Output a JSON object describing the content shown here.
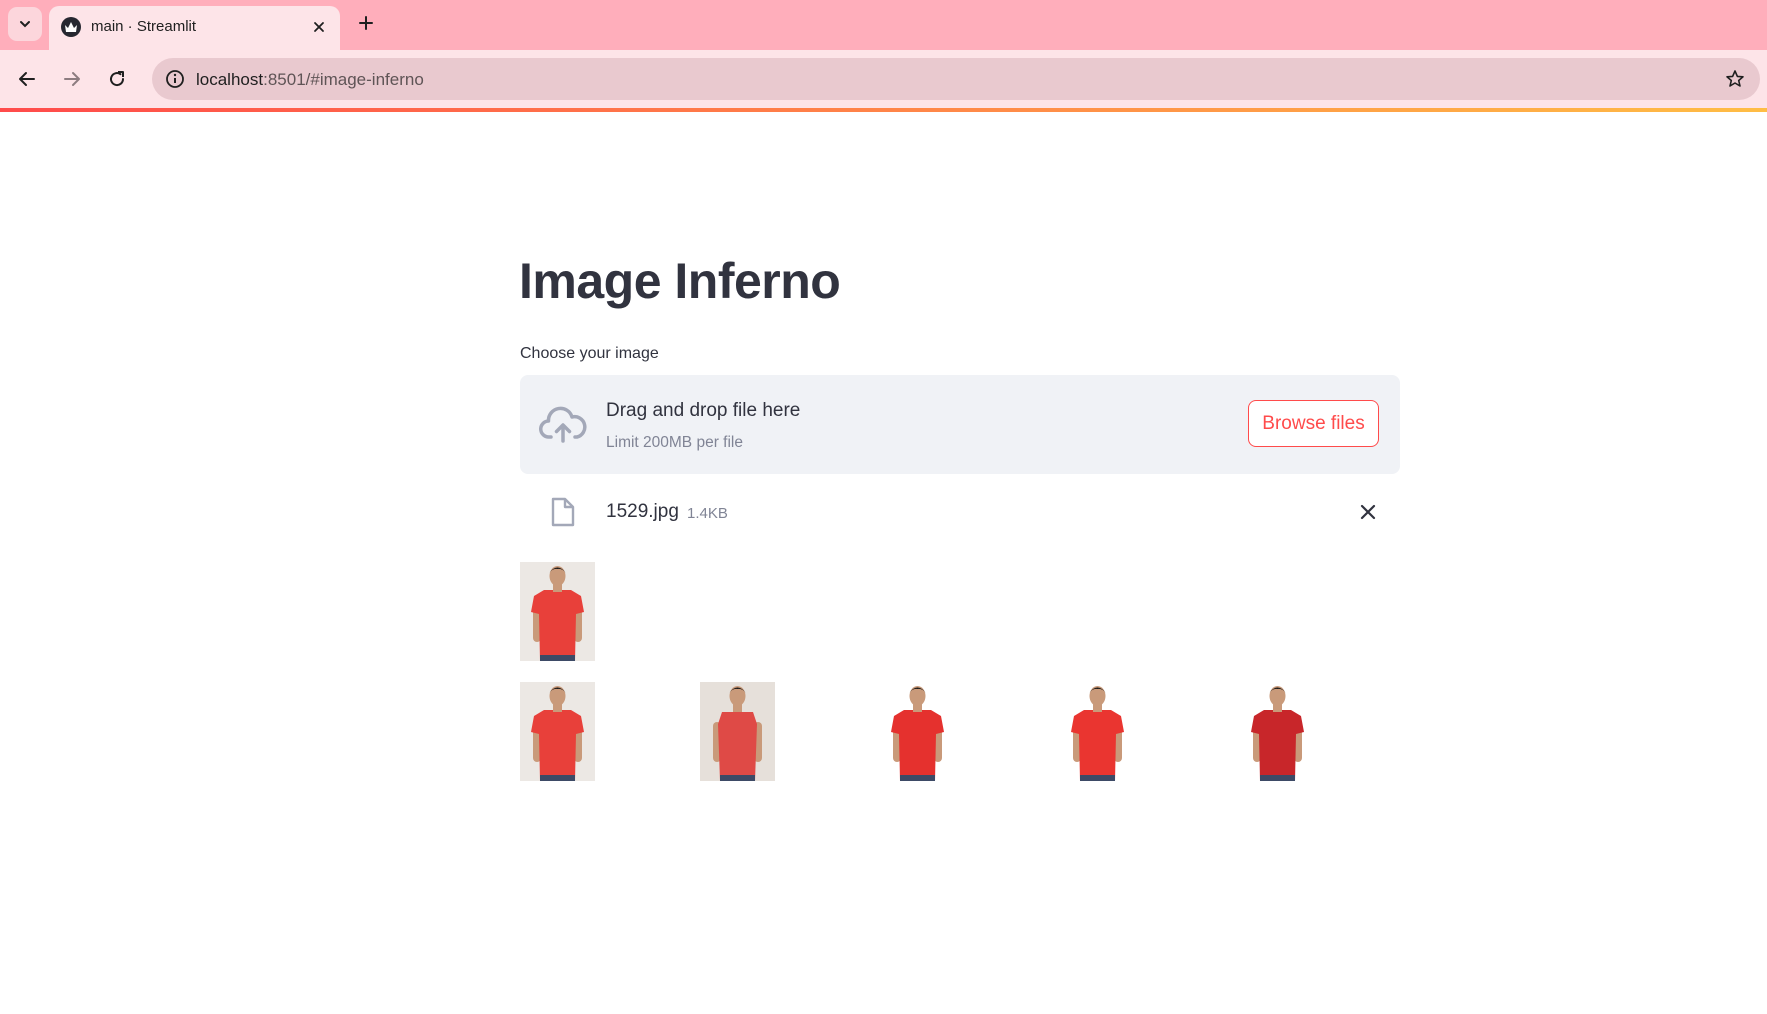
{
  "browser": {
    "tab_title": "main · Streamlit",
    "url_host": "localhost",
    "url_path": ":8501/#image-inferno",
    "icons": [
      "chevron-down-icon",
      "streamlit-favicon",
      "close-icon",
      "plus-icon",
      "back-arrow-icon",
      "forward-arrow-icon",
      "reload-icon",
      "info-icon",
      "star-icon"
    ]
  },
  "app": {
    "title": "Image Inferno",
    "uploader": {
      "label": "Choose your image",
      "drop_text": "Drag and drop file here",
      "limit_text": "Limit 200MB per file",
      "browse_label": "Browse files"
    },
    "uploaded_file": {
      "name": "1529.jpg",
      "size": "1.4KB"
    },
    "query_image": {
      "subject": "man in red t-shirt",
      "bg": "#ece8e4",
      "shirt": "#e8403a"
    },
    "results": [
      {
        "subject": "man in red t-shirt",
        "bg": "#ece8e4",
        "shirt": "#e8403a"
      },
      {
        "subject": "man in red sleeveless shirt",
        "bg": "#e6e0da",
        "shirt": "#df4a46"
      },
      {
        "subject": "man in red t-shirt",
        "bg": "#ffffff",
        "shirt": "#e5312e"
      },
      {
        "subject": "man in red t-shirt",
        "bg": "#ffffff",
        "shirt": "#ea3530"
      },
      {
        "subject": "man in red graphic t-shirt",
        "bg": "#ffffff",
        "shirt": "#c8262a"
      }
    ],
    "colors": {
      "accent": "#ff4b4b",
      "text": "#31333f",
      "muted": "#808495",
      "dropzone_bg": "#f0f2f6"
    }
  }
}
